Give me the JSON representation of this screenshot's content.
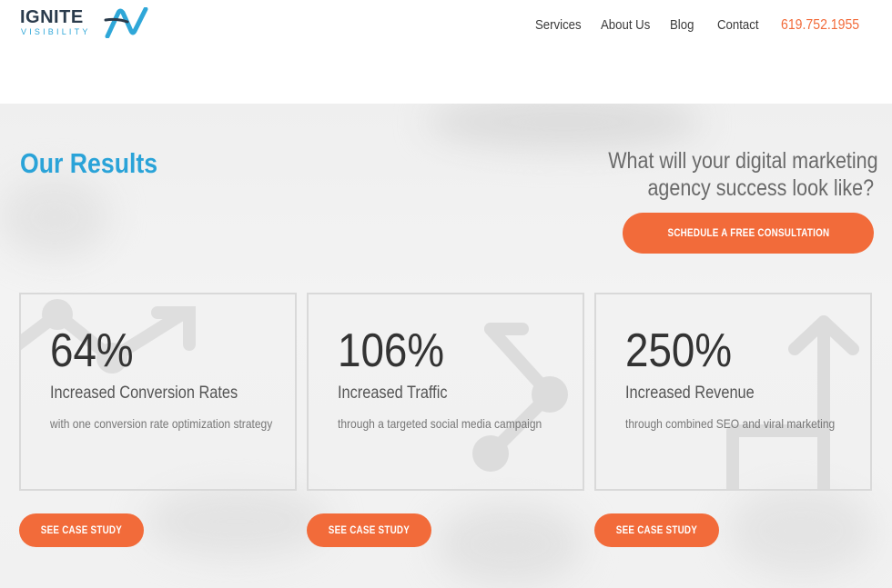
{
  "header": {
    "logo": {
      "word": "IGNITE",
      "sub": "VISIBILITY"
    },
    "nav": {
      "items": [
        "Services",
        "About Us",
        "Blog",
        "Contact"
      ],
      "phone": "619.752.1955"
    }
  },
  "results": {
    "title": "Our Results",
    "question_line1": "What will your digital marketing",
    "question_line2": "agency success look like?",
    "cta_label": "SCHEDULE A FREE CONSULTATION",
    "cards": [
      {
        "stat": "64%",
        "label": "Increased Conversion Rates",
        "desc": "with one conversion rate optimization strategy",
        "button": "SEE CASE STUDY",
        "icon": "growth-arrow-chart-icon"
      },
      {
        "stat": "106%",
        "label": "Increased Traffic",
        "desc": "through a targeted social media campaign",
        "button": "SEE CASE STUDY",
        "icon": "network-arrow-icon"
      },
      {
        "stat": "250%",
        "label": "Increased Revenue",
        "desc": "through combined SEO and viral marketing",
        "button": "SEE CASE STUDY",
        "icon": "upward-arrow-flow-icon"
      }
    ]
  },
  "colors": {
    "accent_orange": "#f26b3a",
    "title_blue": "#2aa3d8",
    "logo_dark": "#2a3b4c"
  }
}
